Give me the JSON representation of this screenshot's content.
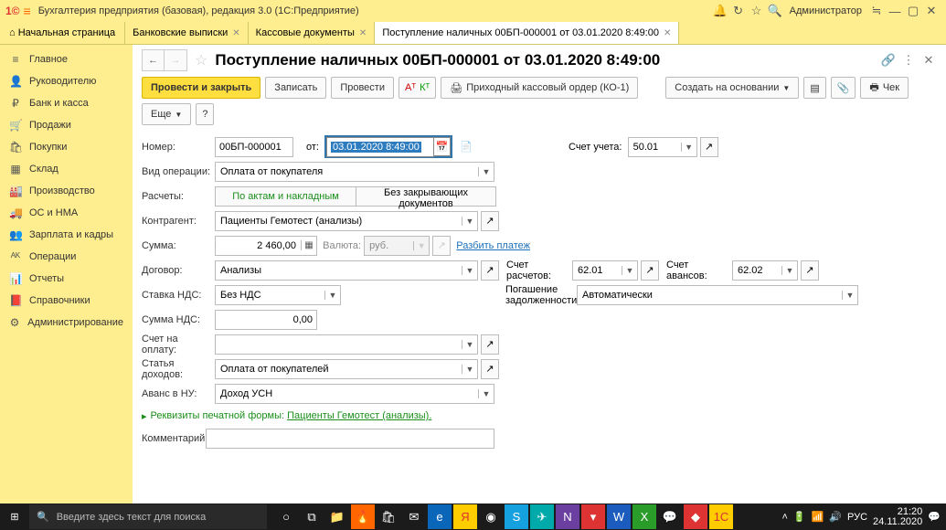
{
  "titlebar": {
    "app": "Бухгалтерия предприятия (базовая), редакция 3.0  (1С:Предприятие)",
    "admin": "Администратор"
  },
  "tabs": {
    "home": "Начальная страница",
    "t1": "Банковские выписки",
    "t2": "Кассовые документы",
    "t3": "Поступление наличных 00БП-000001 от 03.01.2020 8:49:00"
  },
  "nav": [
    "Главное",
    "Руководителю",
    "Банк и касса",
    "Продажи",
    "Покупки",
    "Склад",
    "Производство",
    "ОС и НМА",
    "Зарплата и кадры",
    "Операции",
    "Отчеты",
    "Справочники",
    "Администрирование"
  ],
  "page": {
    "title": "Поступление наличных 00БП-000001 от 03.01.2020 8:49:00"
  },
  "toolbar": {
    "postClose": "Провести и закрыть",
    "write": "Записать",
    "post": "Провести",
    "pko": "Приходный кассовый ордер (КО-1)",
    "createBased": "Создать на основании",
    "check": "Чек",
    "more": "Еще"
  },
  "form": {
    "number_l": "Номер:",
    "number": "00БП-000001",
    "from_l": "от:",
    "date": "03.01.2020  8:49:00",
    "acct_l": "Счет учета:",
    "acct": "50.01",
    "optype_l": "Вид операции:",
    "optype": "Оплата от покупателя",
    "calc_l": "Расчеты:",
    "calc_a": "По актам и накладным",
    "calc_b": "Без закрывающих документов",
    "contr_l": "Контрагент:",
    "contr": "Пациенты Гемотест (анализы)",
    "sum_l": "Сумма:",
    "sum": "2 460,00",
    "cur_l": "Валюта:",
    "cur": "руб.",
    "split": "Разбить платеж",
    "contract_l": "Договор:",
    "contract": "Анализы",
    "calc_acct_l": "Счет расчетов:",
    "calc_acct": "62.01",
    "adv_acct_l": "Счет авансов:",
    "adv_acct": "62.02",
    "vat_l": "Ставка НДС:",
    "vat": "Без НДС",
    "debt_l": "Погашение задолженности:",
    "debt": "Автоматически",
    "vatsum_l": "Сумма НДС:",
    "vatsum": "0,00",
    "invacct_l": "Счет на оплату:",
    "invacct": "",
    "income_l": "Статья доходов:",
    "income": "Оплата от покупателей",
    "advnu_l": "Аванс в НУ:",
    "advnu": "Доход УСН",
    "print_l": "Реквизиты печатной формы:",
    "print_v": "Пациенты Гемотест (анализы).",
    "comment_l": "Комментарий:"
  },
  "taskbar": {
    "search": "Введите здесь текст для поиска",
    "lang": "РУС",
    "time": "21:20",
    "date": "24.11.2020"
  }
}
